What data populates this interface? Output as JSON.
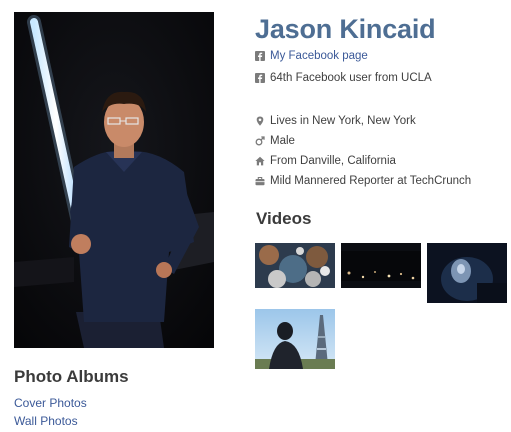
{
  "profile": {
    "name": "Jason Kincaid",
    "facebook_link": "My Facebook page",
    "facebook_note": "64th Facebook user from UCLA",
    "details": [
      {
        "icon": "location-pin-icon",
        "text": "Lives in New York, New York"
      },
      {
        "icon": "male-symbol-icon",
        "text": "Male"
      },
      {
        "icon": "home-icon",
        "text": "From Danville, California"
      },
      {
        "icon": "briefcase-icon",
        "text": "Mild Mannered Reporter at TechCrunch"
      }
    ]
  },
  "videos": {
    "heading": "Videos"
  },
  "albums": {
    "heading": "Photo Albums",
    "items": [
      "Cover Photos",
      "Wall Photos"
    ]
  },
  "colors": {
    "name": "#4e6e93",
    "link": "#3b5998",
    "heading": "#3b3b3b"
  }
}
